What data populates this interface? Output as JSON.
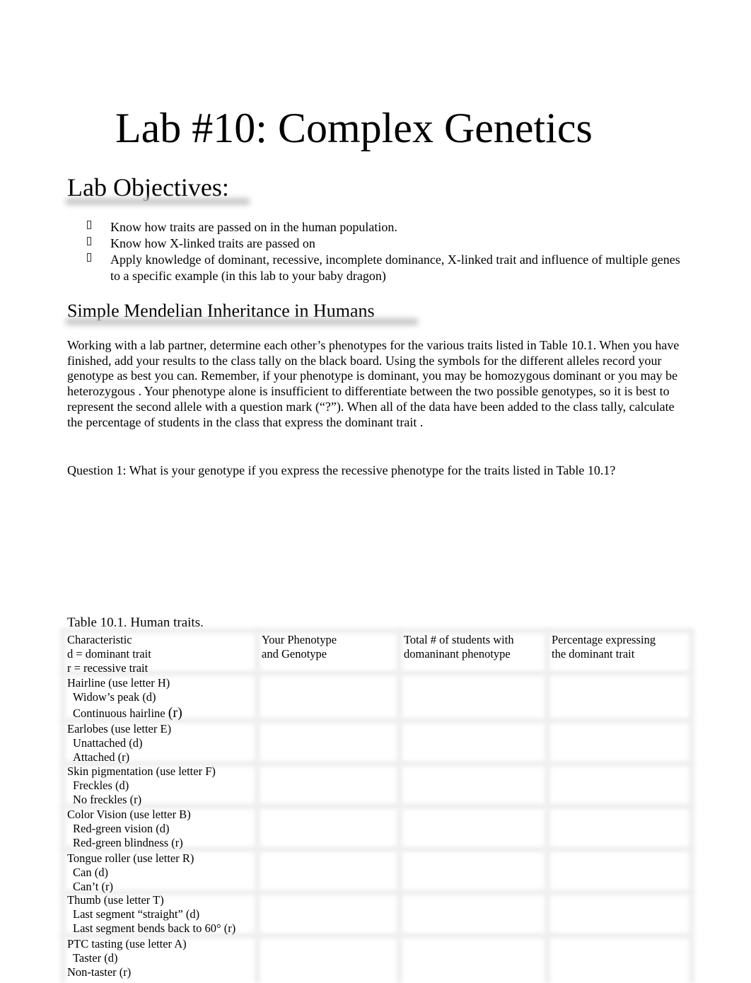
{
  "document": {
    "title": "Lab #10: Complex Genetics",
    "objectives_heading": "Lab Objectives:",
    "objectives": [
      {
        "bullet_icon": "wingdings-bullet",
        "text": "Know how traits are passed on in the human population."
      },
      {
        "bullet_icon": "wingdings-bullet",
        "text": "Know how X-linked traits are passed on"
      },
      {
        "bullet_icon": "wingdings-bullet",
        "text": "Apply knowledge of dominant, recessive, incomplete dominance, X-linked trait and influence of multiple genes to a specific example (in this lab to  your baby dragon)"
      }
    ],
    "section_heading": "Simple Mendelian Inheritance in Humans",
    "paragraph": "Working with a lab partner, determine each other’s phenotypes for the various traits listed in Table  10.1.  When you have finished, add your results to the class tally on the black board.  Using the symbols for the different alleles record your genotype as best you can.  Remember, if your phenotype is dominant, you may be homozygous dominant   or you may be heterozygous .  Your phenotype alone is  insufficient to differentiate between the two possible genotypes, so it is best to represent the second allele with a question mark (“?”).  When all of the data have been added to the class tally, calculate the percentage of students in the class that express the dominant trait   .",
    "question_1": "Question 1:   What is your genotype if you express the recessive phenotype for the traits listed in Table 10.1?",
    "table": {
      "caption": "Table 10.1.  Human traits.",
      "headers": {
        "col1": [
          "Characteristic",
          "d = dominant trait",
          "r = recessive trait"
        ],
        "col2": [
          "Your Phenotype",
          "and Genotype"
        ],
        "col3": [
          "Total # of students with",
          "domaninant phenotype"
        ],
        "col4": [
          "Percentage expressing",
          "the dominant trait"
        ]
      },
      "rows": [
        {
          "trait": "Hairline (use letter H)",
          "dominant": "Widow’s peak (d)",
          "recessive_label": "Continuous hairline ",
          "recessive_suffix": "(r)",
          "your_value": "",
          "total": "",
          "percentage": ""
        },
        {
          "trait": "Earlobes (use letter E)",
          "dominant": "Unattached (d)",
          "recessive_label": "Attached (r)",
          "recessive_suffix": "",
          "your_value": "",
          "total": "",
          "percentage": ""
        },
        {
          "trait": "Skin pigmentation (use letter F)",
          "dominant": "Freckles (d)",
          "recessive_label": "No freckles (r)",
          "recessive_suffix": "",
          "your_value": "",
          "total": "",
          "percentage": ""
        },
        {
          "trait": "Color Vision (use letter B)",
          "dominant": "Red-green vision (d)",
          "recessive_label": "Red-green blindness (r)",
          "recessive_suffix": "",
          "your_value": "",
          "total": "",
          "percentage": ""
        },
        {
          "trait": "Tongue roller (use letter R)",
          "dominant": "Can (d)",
          "recessive_label": "Can’t (r)",
          "recessive_suffix": "",
          "your_value": "",
          "total": "",
          "percentage": ""
        },
        {
          "trait": "Thumb (use letter T)",
          "dominant": "Last segment “straight” (d)",
          "recessive_label": "Last segment bends back to 60° (r)",
          "recessive_suffix": "",
          "your_value": "",
          "total": "",
          "percentage": ""
        },
        {
          "trait": "PTC tasting (use letter A)",
          "dominant": "Taster (d)",
          "recessive_label": "Non-taster (r)",
          "recessive_suffix": "",
          "your_value": "",
          "total": "",
          "percentage": ""
        }
      ]
    }
  }
}
